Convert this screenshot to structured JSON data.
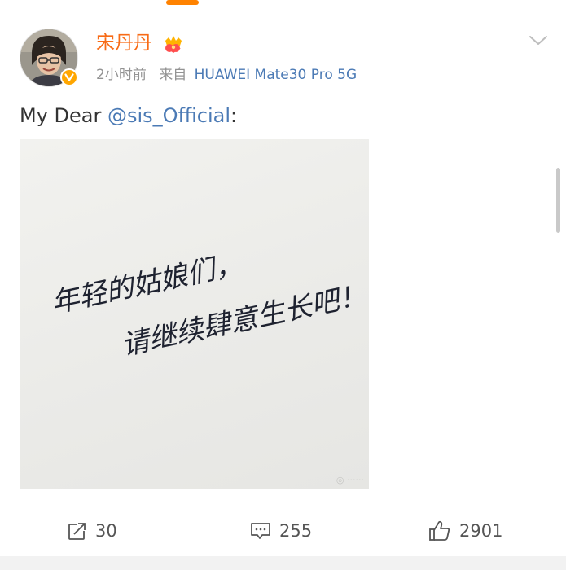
{
  "post": {
    "author": "宋丹丹",
    "time": "2小时前",
    "source_prefix": "来自",
    "device": "HUAWEI Mate30 Pro 5G",
    "text_prefix": "My Dear ",
    "mention": "@sis_Official",
    "text_suffix": ":",
    "image": {
      "handwriting_line1": "年轻的姑娘们，",
      "handwriting_line2": "请继续肆意生长吧！"
    }
  },
  "actions": {
    "repost_count": "30",
    "comment_count": "255",
    "like_count": "2901"
  },
  "colors": {
    "author": "#f86b16",
    "link": "#4b7ab5",
    "meta": "#939393",
    "accent": "#ff8200"
  },
  "icons": {
    "verified": "verified-badge-icon",
    "member": "member-crown-icon",
    "menu": "chevron-down-icon",
    "repost": "repost-icon",
    "comment": "comment-icon",
    "like": "like-icon"
  }
}
